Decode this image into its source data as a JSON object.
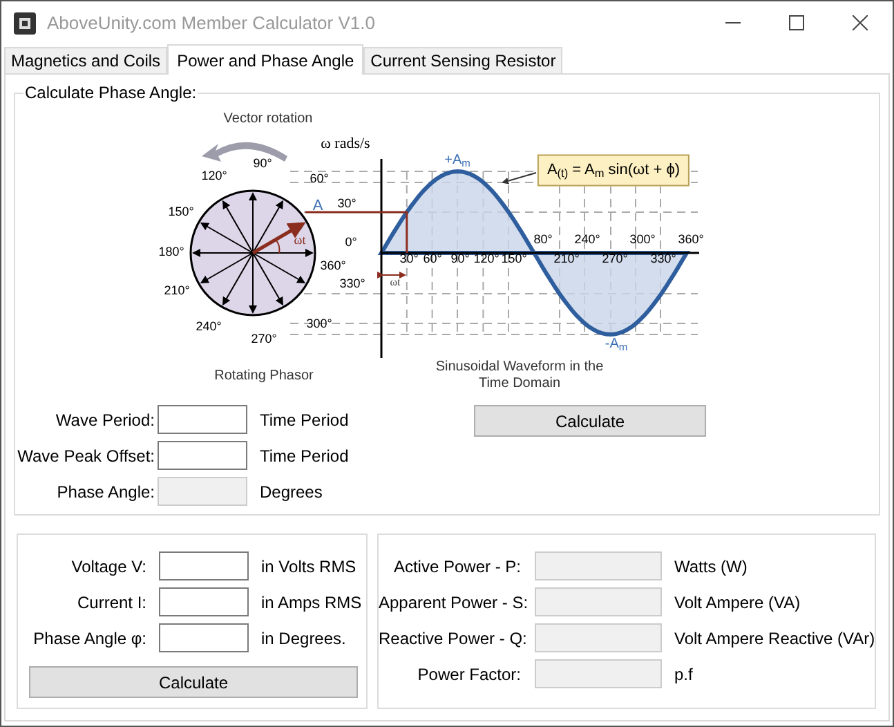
{
  "window": {
    "title": "AboveUnity.com Member Calculator V1.0"
  },
  "tabs": [
    {
      "label": "Magnetics and Coils",
      "selected": false
    },
    {
      "label": "Power and Phase Angle",
      "selected": true
    },
    {
      "label": "Current Sensing Resistor",
      "selected": false
    }
  ],
  "phase_angle_group": {
    "title": "Calculate Phase Angle:",
    "diagram": {
      "phasor": {
        "title": "Vector rotation",
        "speed": "ω rads/s",
        "angle_labels": [
          "90°",
          "120°",
          "60°",
          "30°",
          "150°",
          "0°",
          "180°",
          "360°",
          "330°",
          "210°",
          "300°",
          "240°",
          "270°"
        ],
        "vector_label": "A",
        "angle_symbol": "ωt",
        "caption": "Rotating Phasor"
      },
      "waveform": {
        "peak": "+A$_{m}$",
        "formula": "A$_{(t)}$ = A$_{m}$ sin(ωt + ϕ)",
        "axis_labels": [
          "80°",
          "240°",
          "300°",
          "360°",
          "30°",
          "60°",
          "90°",
          "120°",
          "150°",
          "210°",
          "270°",
          "330°"
        ],
        "angle_symbol": "ωt",
        "trough": "-A$_{m}$",
        "caption": "Sinusoidal Waveform in the Time Domain"
      }
    },
    "fields": [
      {
        "label": "Wave Period:",
        "unit": "Time Period",
        "disabled": false
      },
      {
        "label": "Wave Peak Offset:",
        "unit": "Time Period",
        "disabled": false
      },
      {
        "label": "Phase Angle:",
        "unit": "Degrees",
        "disabled": true
      }
    ],
    "button": "Calculate"
  },
  "power_group": {
    "fields": [
      {
        "label": "Voltage V:",
        "unit": "in Volts RMS",
        "disabled": false
      },
      {
        "label": "Current I:",
        "unit": "in Amps RMS",
        "disabled": false
      },
      {
        "label": "Phase Angle φ:",
        "unit": "in Degrees.",
        "disabled": false
      }
    ],
    "button": "Calculate"
  },
  "results_group": {
    "fields": [
      {
        "label": "Active Power - P:",
        "unit": "Watts (W)",
        "disabled": true
      },
      {
        "label": "Apparent Power - S:",
        "unit": "Volt Ampere (VA)",
        "disabled": true
      },
      {
        "label": "Reactive Power - Q:",
        "unit": "Volt Ampere Reactive (VAr)",
        "disabled": true
      },
      {
        "label": "Power Factor:",
        "unit": "p.f",
        "disabled": true
      }
    ]
  }
}
